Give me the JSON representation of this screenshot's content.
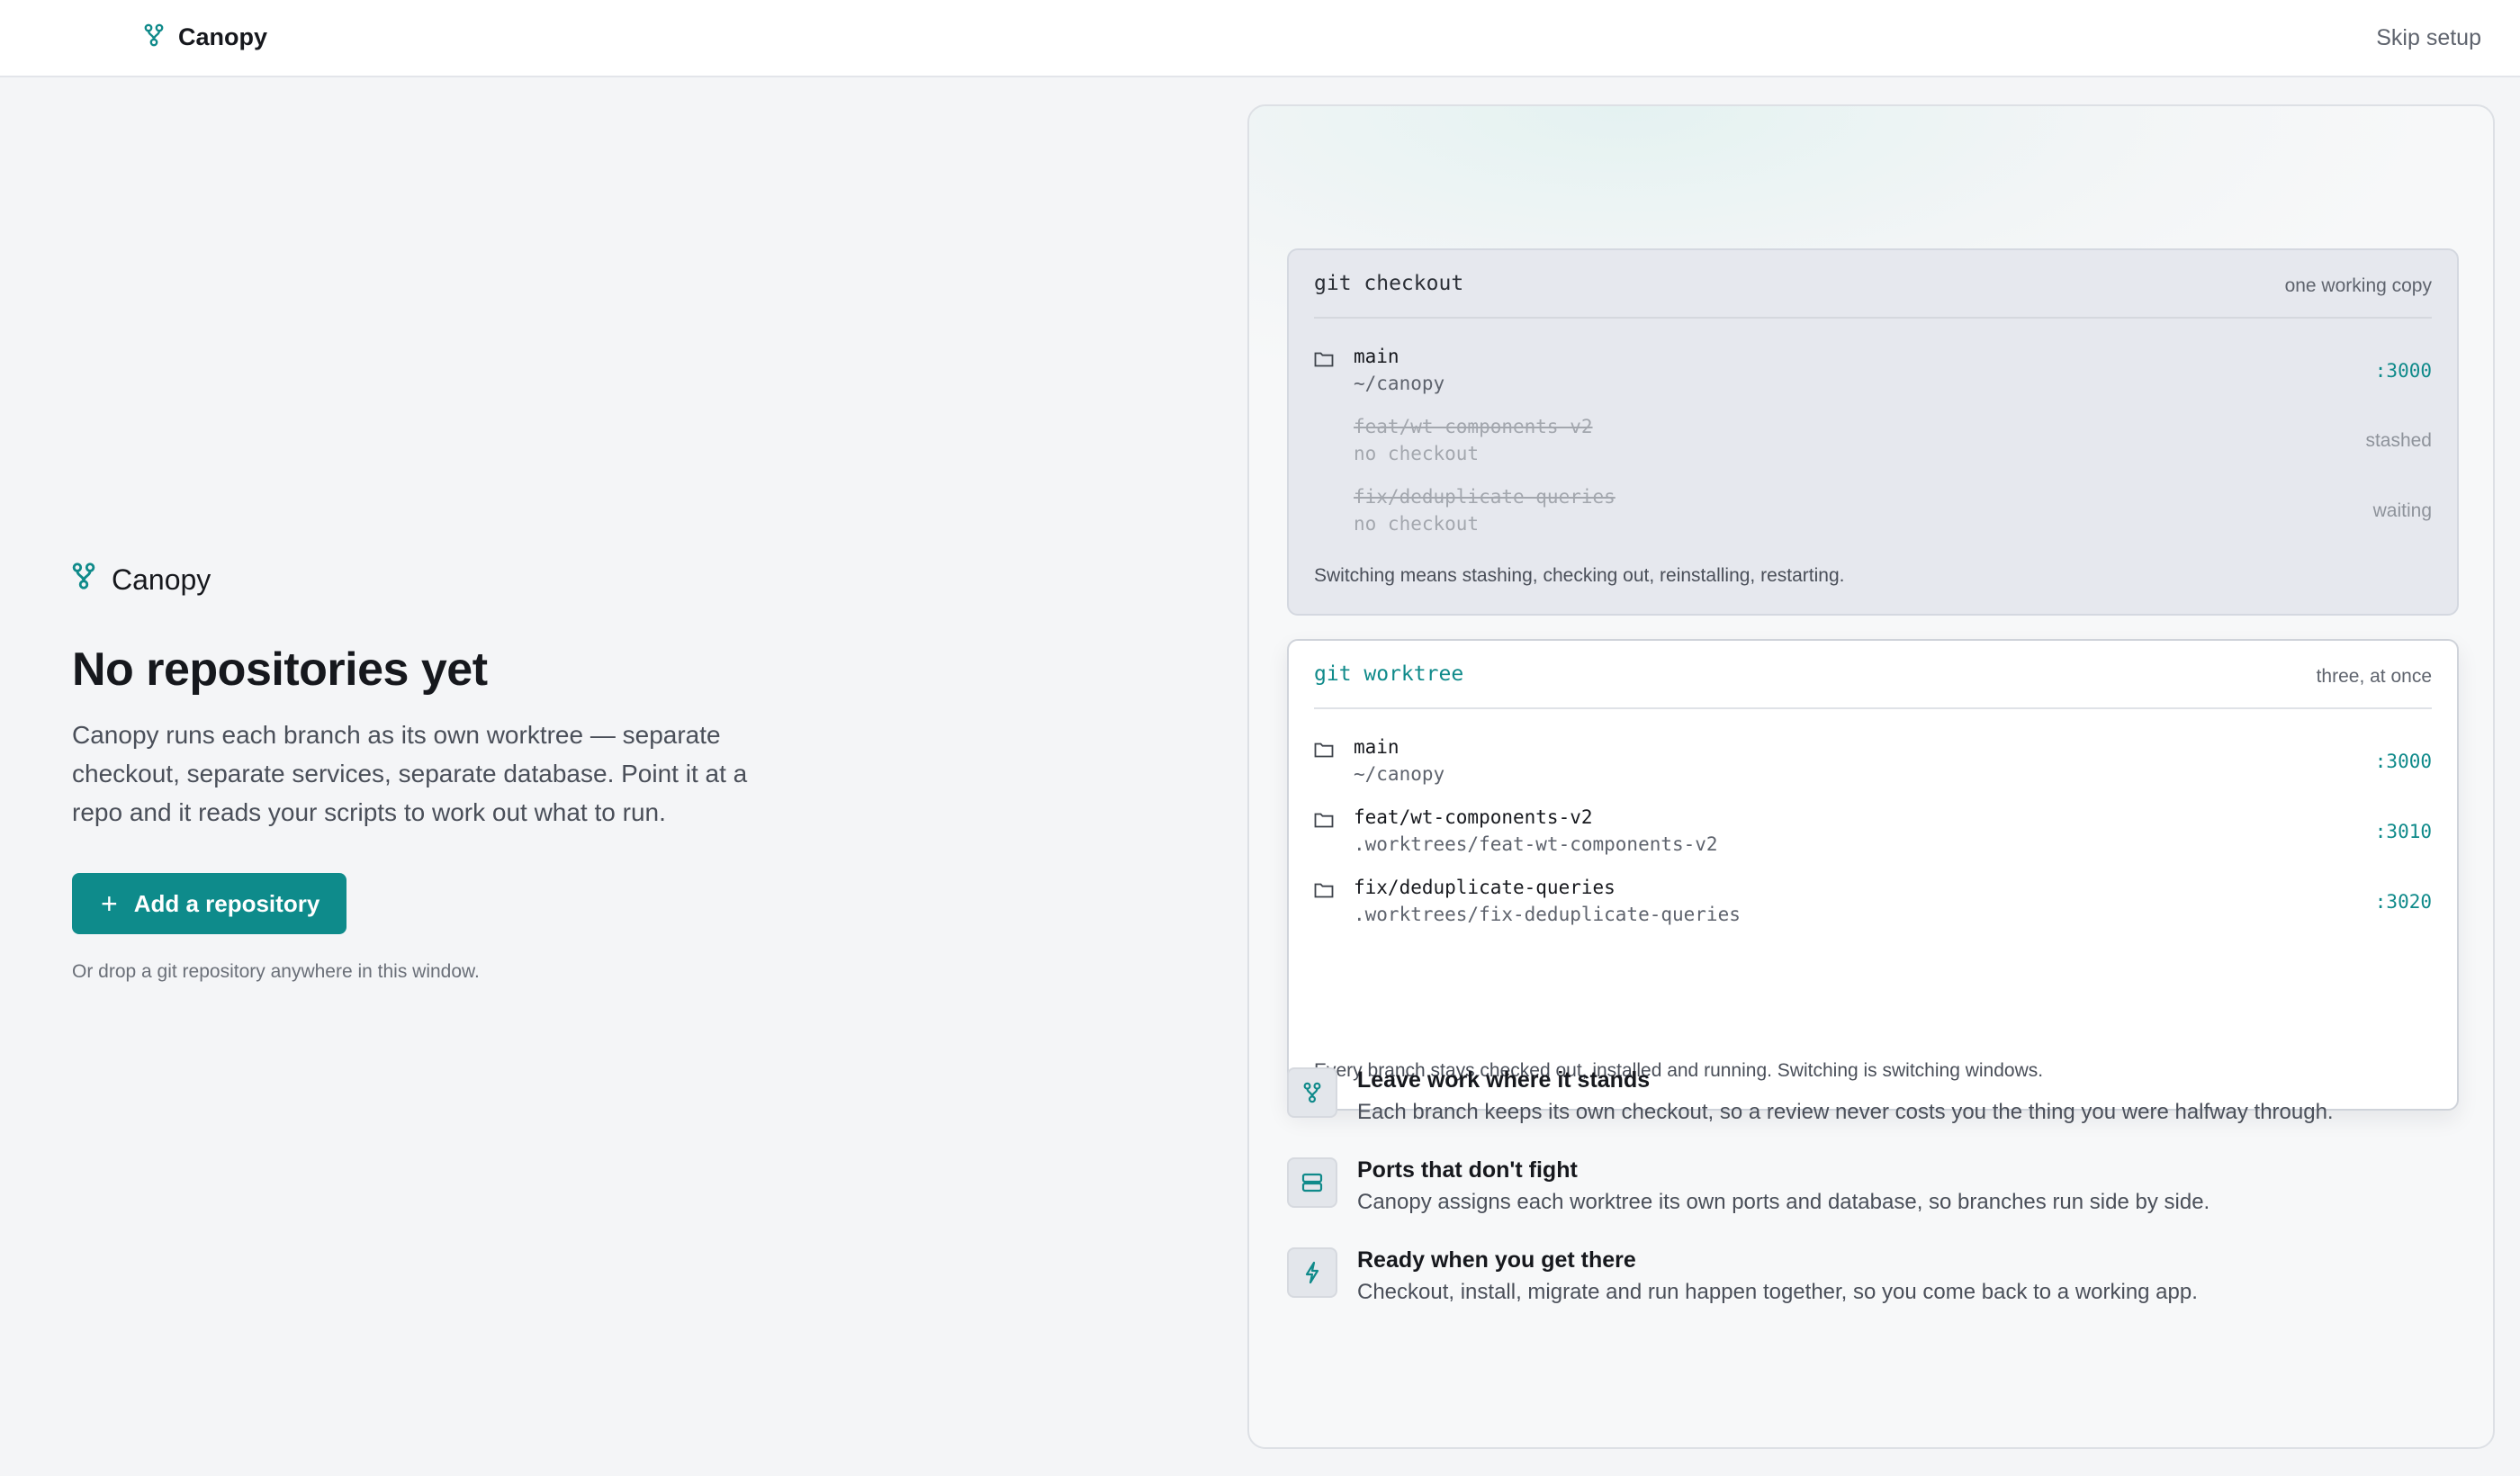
{
  "app": {
    "name": "Canopy"
  },
  "topbar": {
    "brand": "Canopy",
    "skip_label": "Skip setup"
  },
  "empty_state": {
    "brand": "Canopy",
    "title": "No repositories yet",
    "description": "Canopy runs each branch as its own worktree — separate checkout, separate services, separate database. Point it at a repo and it reads your scripts to work out what to run.",
    "add_button": "Add a repository",
    "add_button_icon": "plus-icon",
    "hint": "Or drop a git repository anywhere in this window."
  },
  "checkout_card": {
    "title": "git checkout",
    "subtitle": "one working copy",
    "rows": [
      {
        "name": "main",
        "path": "~/canopy",
        "right": ":3000",
        "kind": "port"
      },
      {
        "name": "feat/wt-components-v2",
        "path": "no checkout",
        "right": "stashed",
        "kind": "status"
      },
      {
        "name": "fix/deduplicate-queries",
        "path": "no checkout",
        "right": "waiting",
        "kind": "status"
      }
    ],
    "footer": "Switching means stashing, checking out, reinstalling, restarting."
  },
  "worktree_card": {
    "title": "git worktree",
    "subtitle": "three, at once",
    "rows": [
      {
        "name": "main",
        "path": "~/canopy",
        "right": ":3000"
      },
      {
        "name": "feat/wt-components-v2",
        "path": ".worktrees/feat-wt-components-v2",
        "right": ":3010"
      },
      {
        "name": "fix/deduplicate-queries",
        "path": ".worktrees/fix-deduplicate-queries",
        "right": ":3020"
      }
    ],
    "footer": "Every branch stays checked out, installed and running. Switching is switching windows."
  },
  "features": [
    {
      "icon": "branch-icon",
      "title": "Leave work where it stands",
      "description": "Each branch keeps its own checkout, so a review never costs you the thing you were halfway through."
    },
    {
      "icon": "server-icon",
      "title": "Ports that don't fight",
      "description": "Canopy assigns each worktree its own ports and database, so branches run side by side."
    },
    {
      "icon": "bolt-icon",
      "title": "Ready when you get there",
      "description": "Checkout, install, migrate and run happen together, so you come back to a working app."
    }
  ],
  "colors": {
    "accent": "#0e8b8b",
    "background": "#f4f5f7"
  }
}
